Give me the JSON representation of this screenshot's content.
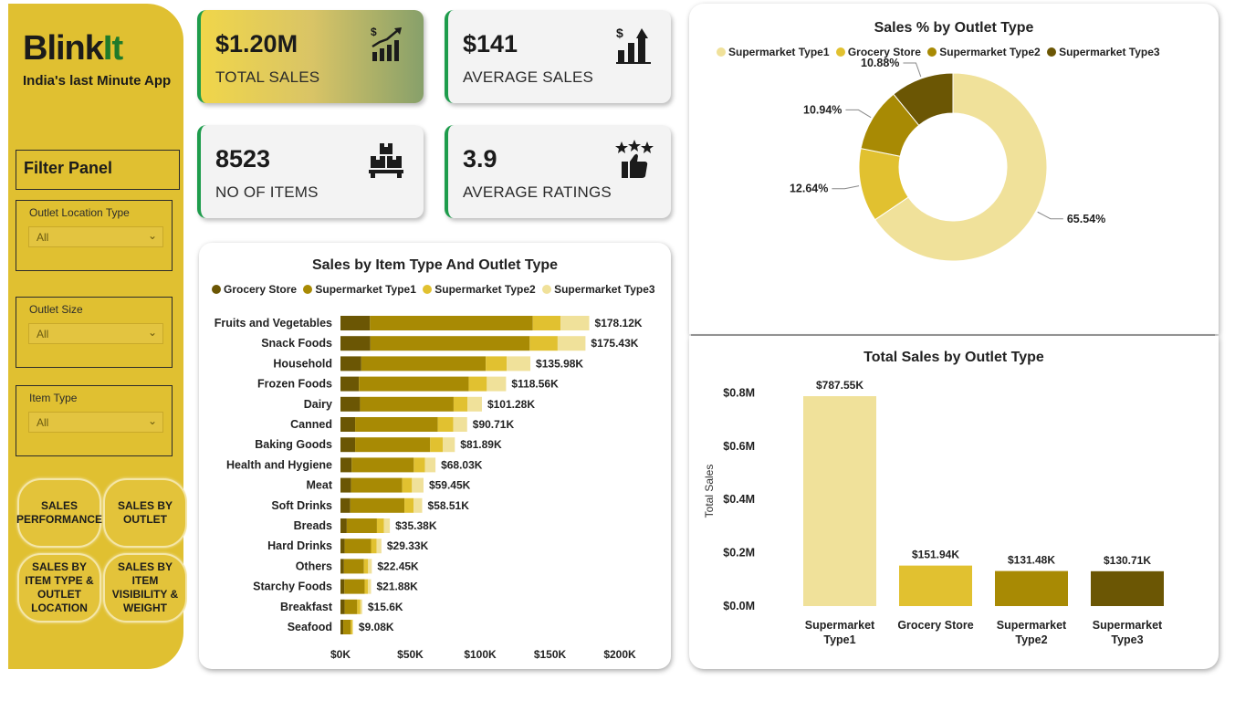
{
  "colors": {
    "grocery_store": "#6b5604",
    "supermarket_type1": "#a88a04",
    "supermarket_type2": "#e1c130",
    "supermarket_type3": "#f0e19a",
    "sidebar": "#e0c031",
    "brand_green": "#1f7a2a",
    "kpi_border": "#1e9c4c"
  },
  "brand": {
    "name_part1": "Blink",
    "name_part2": "It",
    "tagline": "India's last Minute App"
  },
  "filter_panel": {
    "title": "Filter Panel",
    "slicers": [
      {
        "label": "Outlet Location Type",
        "value": "All"
      },
      {
        "label": "Outlet Size",
        "value": "All"
      },
      {
        "label": "Item Type",
        "value": "All"
      }
    ]
  },
  "nav_buttons": [
    {
      "label": "SALES PERFORMANCE"
    },
    {
      "label": "SALES BY OUTLET"
    },
    {
      "label": "SALES BY ITEM TYPE & OUTLET LOCATION"
    },
    {
      "label": "SALES BY ITEM VISIBILITY & WEIGHT"
    }
  ],
  "kpis": [
    {
      "value": "$1.20M",
      "caption": "TOTAL SALES",
      "icon": "growth-chart-dollar-icon"
    },
    {
      "value": "$141",
      "caption": "AVERAGE SALES",
      "icon": "bar-chart-dollar-icon"
    },
    {
      "value": "8523",
      "caption": "NO OF ITEMS",
      "icon": "boxes-icon"
    },
    {
      "value": "3.9",
      "caption": "AVERAGE RATINGS",
      "icon": "thumbs-up-stars-icon"
    }
  ],
  "chart_data": [
    {
      "type": "bar",
      "orientation": "horizontal",
      "stacked": true,
      "title": "Sales by Item Type And Outlet Type",
      "legend_position": "top",
      "series_order": [
        "Grocery Store",
        "Supermarket Type1",
        "Supermarket Type2",
        "Supermarket Type3"
      ],
      "categories": [
        "Fruits and Vegetables",
        "Snack Foods",
        "Household",
        "Frozen Foods",
        "Dairy",
        "Canned",
        "Baking Goods",
        "Health and Hygiene",
        "Meat",
        "Soft Drinks",
        "Breads",
        "Hard Drinks",
        "Others",
        "Starchy Foods",
        "Breakfast",
        "Seafood"
      ],
      "total_labels": [
        "$178.12K",
        "$175.43K",
        "$135.98K",
        "$118.56K",
        "$101.28K",
        "$90.71K",
        "$81.89K",
        "$68.03K",
        "$59.45K",
        "$58.51K",
        "$35.38K",
        "$29.33K",
        "$22.45K",
        "$21.88K",
        "$15.6K",
        "$9.08K"
      ],
      "series": [
        {
          "name": "Grocery Store",
          "values": [
            21.1,
            21.4,
            14.9,
            13.2,
            14.0,
            10.5,
            10.5,
            8.0,
            7.6,
            7.0,
            4.5,
            3.0,
            2.5,
            2.8,
            3.0,
            2.0
          ]
        },
        {
          "name": "Supermarket Type1",
          "values": [
            116.6,
            114.1,
            89.1,
            78.6,
            67.0,
            59.2,
            53.7,
            44.5,
            36.6,
            38.8,
            21.6,
            18.9,
            14.3,
            14.5,
            9.0,
            5.4
          ]
        },
        {
          "name": "Supermarket Type2",
          "values": [
            19.9,
            20.0,
            15.0,
            13.0,
            10.0,
            11.0,
            9.0,
            8.0,
            7.0,
            6.6,
            5.0,
            4.0,
            3.0,
            2.3,
            2.3,
            1.2
          ]
        },
        {
          "name": "Supermarket Type3",
          "values": [
            20.52,
            19.93,
            16.98,
            13.76,
            10.28,
            10.01,
            8.69,
            7.53,
            8.25,
            6.11,
            4.28,
            3.43,
            2.65,
            2.28,
            1.3,
            0.48
          ]
        }
      ],
      "x_ticks": [
        "$0K",
        "$50K",
        "$100K",
        "$150K",
        "$200K"
      ],
      "xlim": [
        0,
        200
      ]
    },
    {
      "type": "pie",
      "donut": true,
      "title": "Sales % by Outlet Type",
      "legend_position": "top",
      "labels": [
        "Supermarket Type1",
        "Grocery Store",
        "Supermarket Type2",
        "Supermarket Type3"
      ],
      "values": [
        65.54,
        12.64,
        10.94,
        10.88
      ],
      "value_labels": [
        "65.54%",
        "12.64%",
        "10.94%",
        "10.88%"
      ]
    },
    {
      "type": "bar",
      "orientation": "vertical",
      "title": "Total Sales by Outlet Type",
      "ylabel": "Total Sales",
      "categories": [
        "Supermarket Type1",
        "Grocery Store",
        "Supermarket Type2",
        "Supermarket Type3"
      ],
      "category_lines": [
        [
          "Supermarket",
          "Type1"
        ],
        [
          "Grocery Store"
        ],
        [
          "Supermarket",
          "Type2"
        ],
        [
          "Supermarket",
          "Type3"
        ]
      ],
      "values": [
        787.55,
        151.94,
        131.48,
        130.71
      ],
      "value_labels": [
        "$787.55K",
        "$151.94K",
        "$131.48K",
        "$130.71K"
      ],
      "y_ticks": [
        "$0.0M",
        "$0.2M",
        "$0.4M",
        "$0.6M",
        "$0.8M"
      ],
      "ylim": [
        0,
        800
      ]
    }
  ]
}
